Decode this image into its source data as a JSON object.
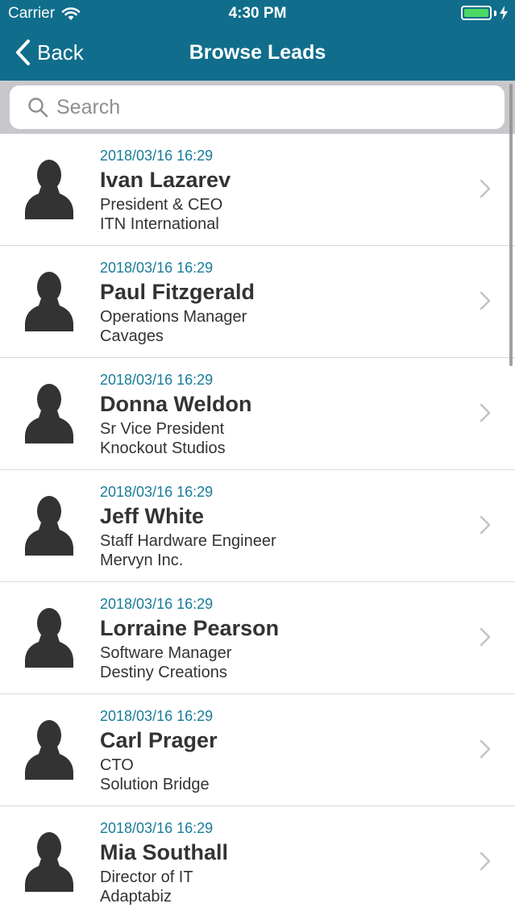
{
  "status_bar": {
    "carrier": "Carrier",
    "time": "4:30 PM",
    "battery_level": 1.0
  },
  "nav": {
    "back_label": "Back",
    "title": "Browse Leads"
  },
  "search": {
    "placeholder": "Search",
    "value": ""
  },
  "colors": {
    "nav_background": "#106e8c",
    "date_text": "#177b99",
    "battery": "#4cd964"
  },
  "icons": {
    "back": "chevron-left-icon",
    "search": "magnifier-icon",
    "avatar": "person-silhouette-icon",
    "row_disclosure": "chevron-right-icon"
  },
  "leads": [
    {
      "date": "2018/03/16 16:29",
      "name": "Ivan Lazarev",
      "position": "President & CEO",
      "company": "ITN International"
    },
    {
      "date": "2018/03/16 16:29",
      "name": "Paul Fitzgerald",
      "position": "Operations Manager",
      "company": "Cavages"
    },
    {
      "date": "2018/03/16 16:29",
      "name": "Donna Weldon",
      "position": "Sr Vice President",
      "company": "Knockout Studios"
    },
    {
      "date": "2018/03/16 16:29",
      "name": "Jeff White",
      "position": "Staff Hardware Engineer",
      "company": "Mervyn Inc."
    },
    {
      "date": "2018/03/16 16:29",
      "name": "Lorraine Pearson",
      "position": "Software Manager",
      "company": "Destiny Creations"
    },
    {
      "date": "2018/03/16 16:29",
      "name": "Carl Prager",
      "position": "CTO",
      "company": "Solution Bridge"
    },
    {
      "date": "2018/03/16 16:29",
      "name": "Mia Southall",
      "position": "Director of IT",
      "company": "Adaptabiz"
    }
  ]
}
